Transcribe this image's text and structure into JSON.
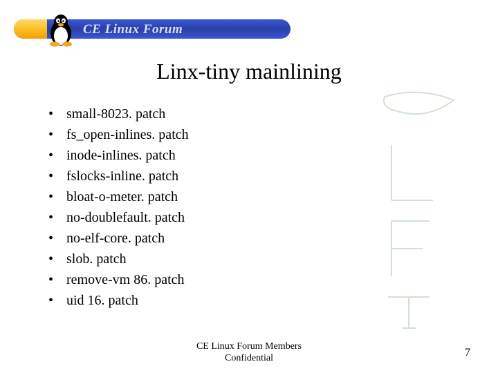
{
  "header": {
    "forum_text": "CE Linux Forum"
  },
  "title": "Linx-tiny mainlining",
  "bullets": [
    "small-8023. patch",
    "fs_open-inlines. patch",
    "inode-inlines. patch",
    "fslocks-inline. patch",
    "bloat-o-meter. patch",
    "no-doublefault. patch",
    "no-elf-core. patch",
    "slob. patch",
    "remove-vm 86. patch",
    "uid 16. patch"
  ],
  "footer_line1": "CE Linux Forum Members",
  "footer_line2": "Confidential",
  "page_number": "7"
}
